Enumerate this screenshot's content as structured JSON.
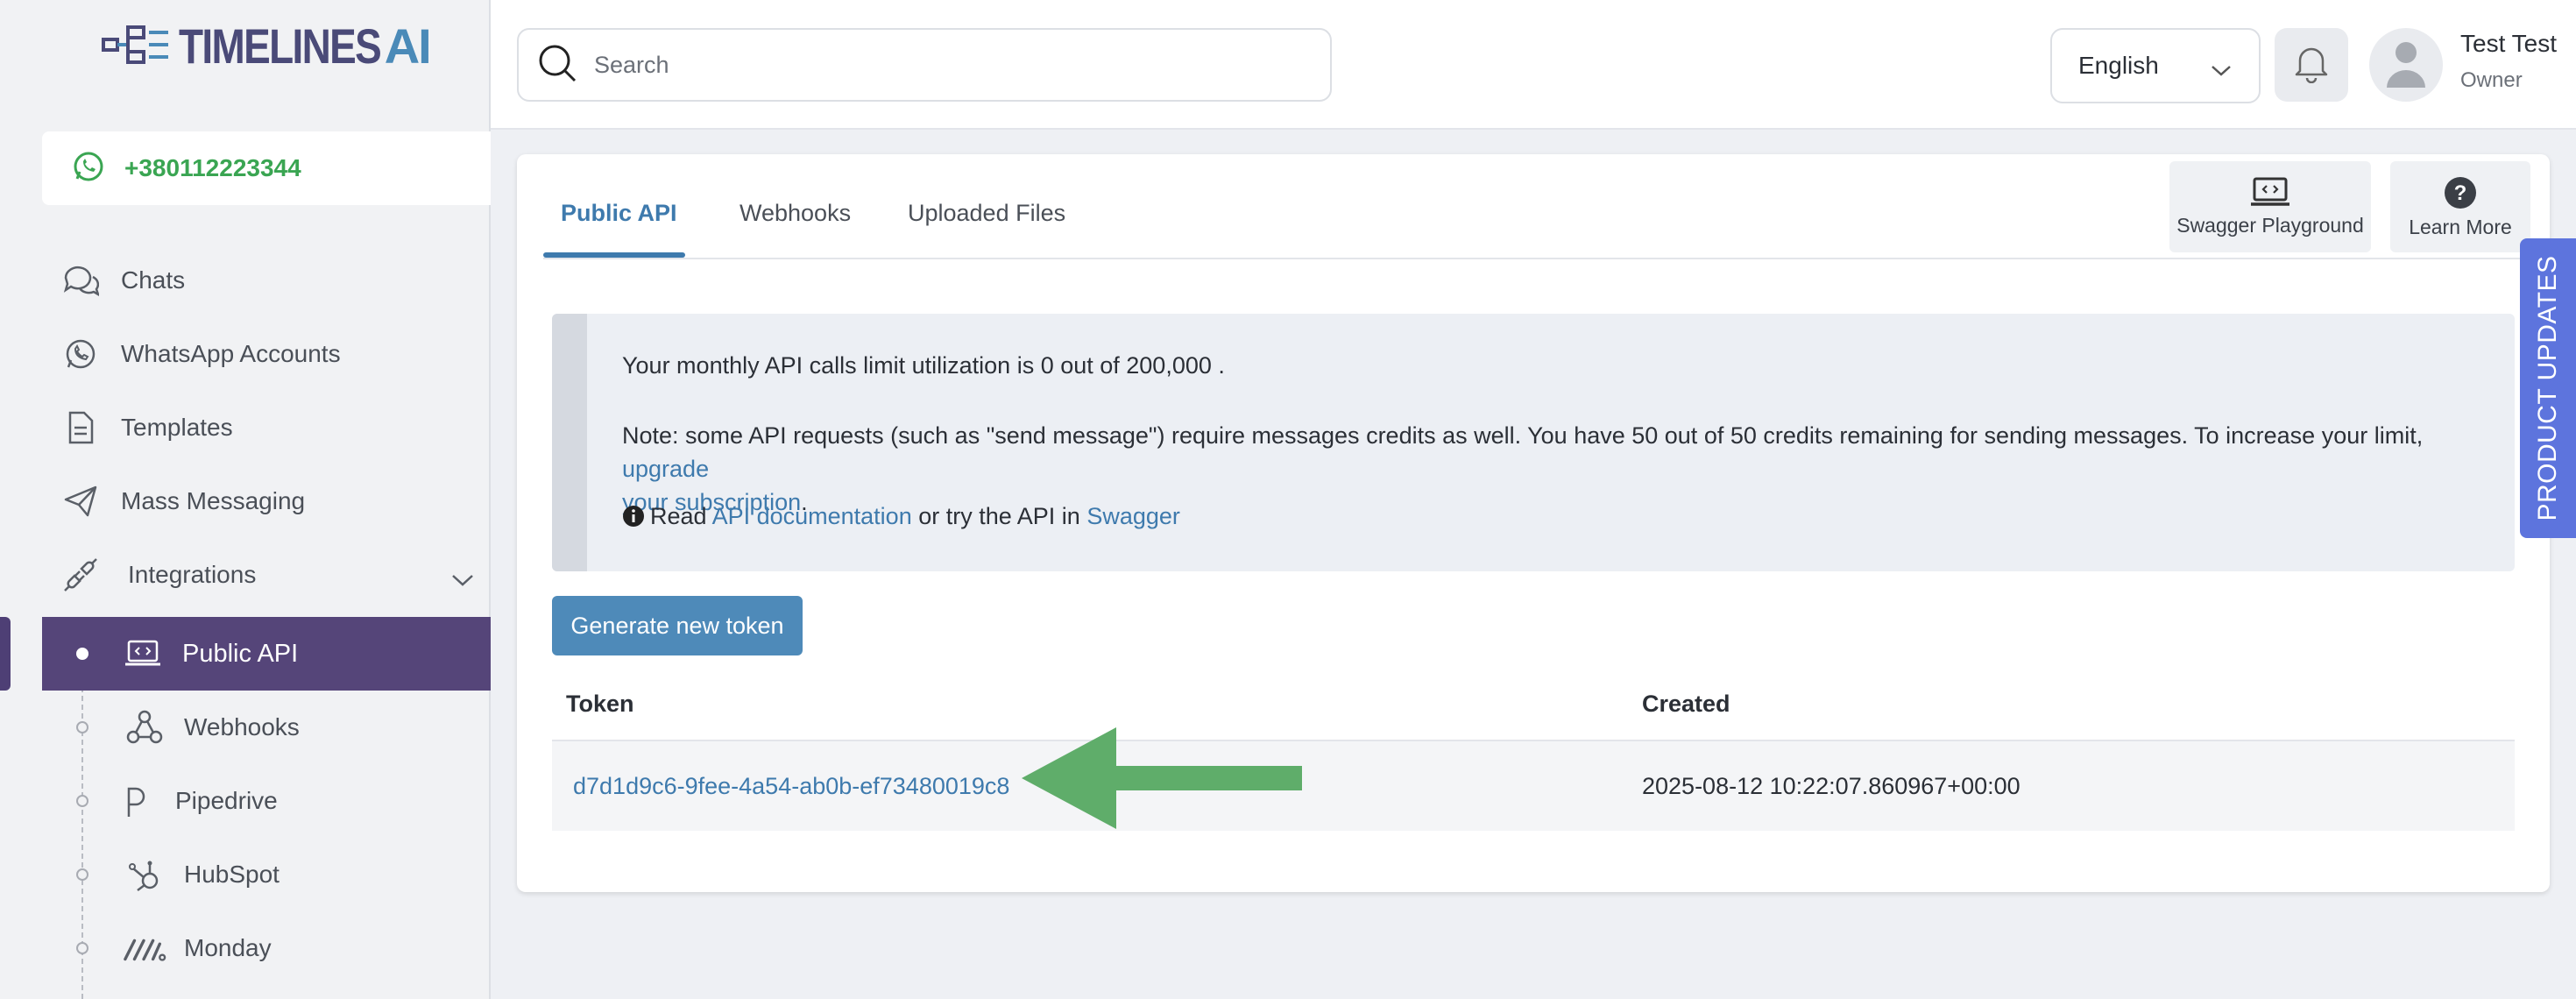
{
  "brand": {
    "part1": "TIMELINES",
    "part2": "AI"
  },
  "phone": {
    "number": "+380112223344"
  },
  "sidebar": {
    "items": [
      {
        "label": "Chats",
        "icon": "chat-icon"
      },
      {
        "label": "WhatsApp Accounts",
        "icon": "whatsapp-icon"
      },
      {
        "label": "Templates",
        "icon": "document-icon"
      },
      {
        "label": "Mass Messaging",
        "icon": "send-icon"
      },
      {
        "label": "Integrations",
        "icon": "plug-icon"
      }
    ],
    "sub_items": [
      {
        "label": "Public API",
        "icon": "api-laptop-icon"
      },
      {
        "label": "Webhooks",
        "icon": "webhook-icon"
      },
      {
        "label": "Pipedrive",
        "icon": "pipedrive-icon"
      },
      {
        "label": "HubSpot",
        "icon": "hubspot-icon"
      },
      {
        "label": "Monday",
        "icon": "monday-icon"
      }
    ]
  },
  "search": {
    "placeholder": "Search"
  },
  "language": {
    "selected": "English"
  },
  "user": {
    "name": "Test Test",
    "role": "Owner"
  },
  "tabs": [
    "Public API",
    "Webhooks",
    "Uploaded Files"
  ],
  "tools": {
    "swagger": "Swagger Playground",
    "learn": "Learn More"
  },
  "info": {
    "usage": "Your monthly API calls limit utilization is 0 out of 200,000 .",
    "note_prefix": "Note: some API requests (such as \"send message\") require messages credits as well. You have 50 out of 50 credits remaining for sending messages. To increase your limit,",
    "note_link_1": "upgrade",
    "note_link_2": "your subscription",
    "note_suffix": ".",
    "read_prefix": "Read",
    "api_doc_link": "API documentation",
    "read_middle": "or try the API in",
    "swagger_link": "Swagger"
  },
  "generate_button": "Generate new token",
  "table": {
    "headers": {
      "token": "Token",
      "created": "Created"
    },
    "rows": [
      {
        "token": "d7d1d9c6-9fee-4a54-ab0b-ef73480019c8",
        "created": "2025-08-12 10:22:07.860967+00:00"
      }
    ]
  },
  "product_updates": "PRODUCT UPDATES",
  "colors": {
    "accent": "#3e7aad",
    "active_nav": "#554579",
    "whatsapp_green": "#3aa552",
    "arrow_green": "#5fad6a",
    "updates_tab": "#5d74dd"
  }
}
